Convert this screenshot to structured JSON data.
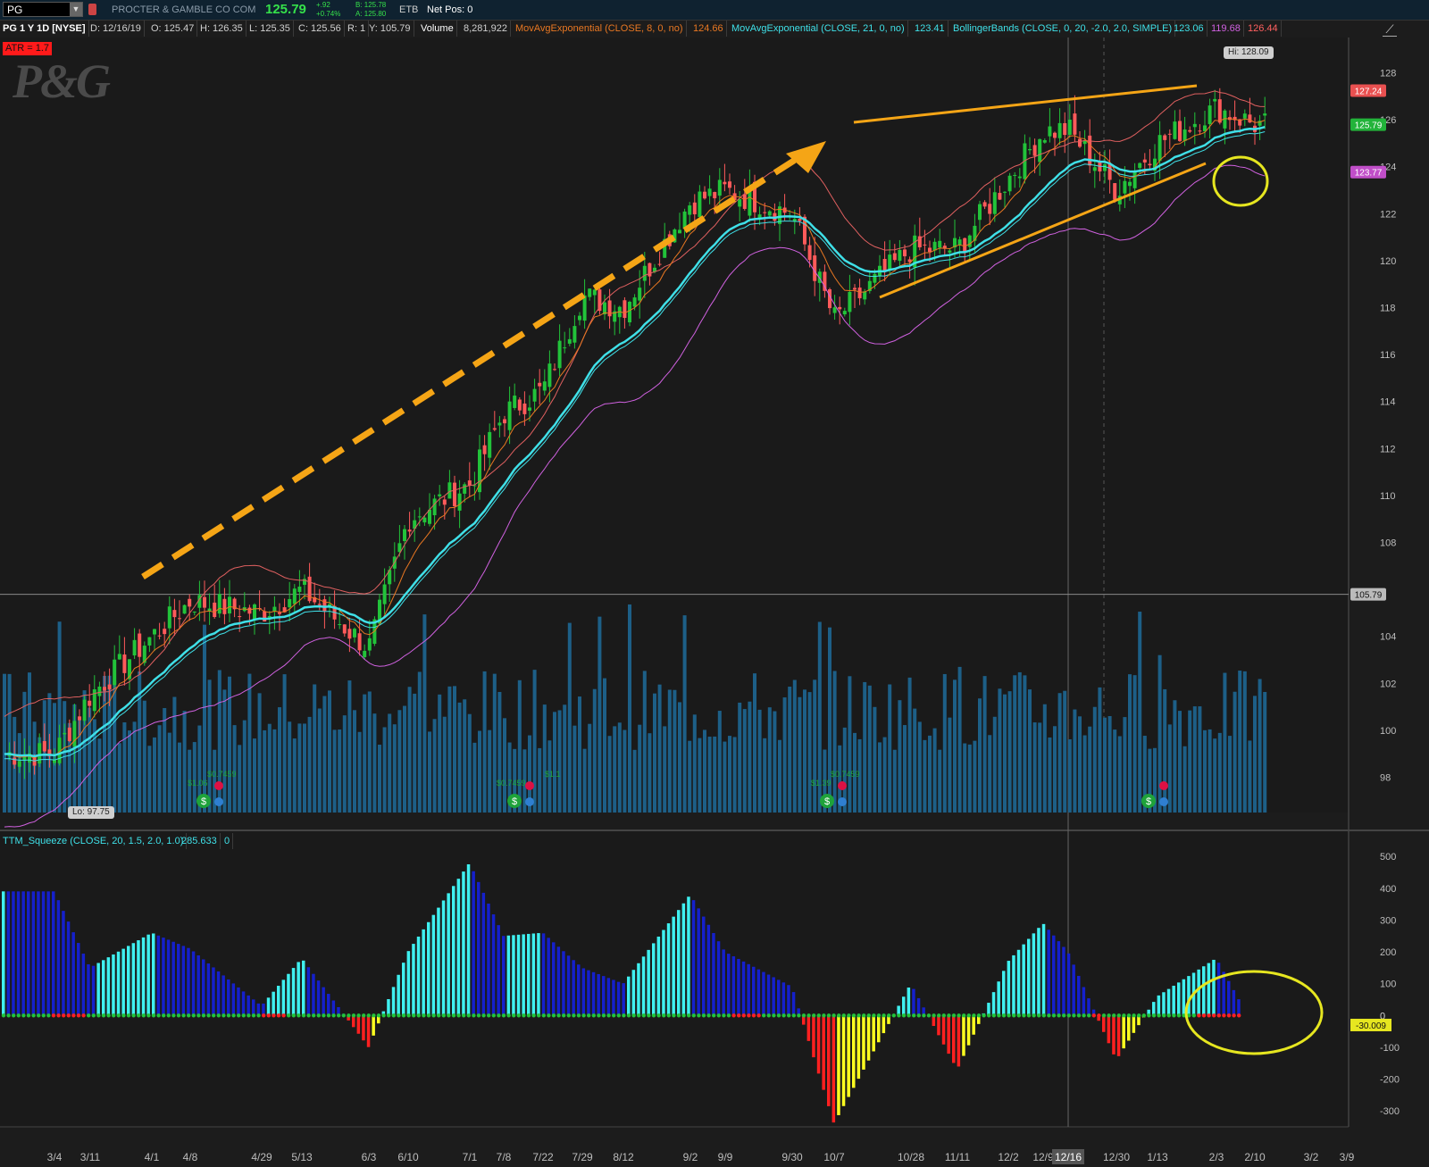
{
  "topbar": {
    "symbol": "PG",
    "company": "PROCTER & GAMBLE CO COM",
    "last": "125.79",
    "change": "+.92",
    "change_pct": "+0.74%",
    "bid": "B: 125.78",
    "ask": "A: 125.80",
    "etb": "ETB",
    "net_pos": "Net Pos: 0"
  },
  "infobar": {
    "title": "PG 1 Y 1D [NYSE]",
    "date": "D: 12/16/19",
    "open": "O: 125.47",
    "high": "H: 126.35",
    "low": "L: 125.35",
    "close": "C: 125.56",
    "r": "R: 1",
    "y": "Y: 105.79",
    "volume_label": "Volume",
    "volume": "8,281,922",
    "ema8_label": "MovAvgExponential (CLOSE, 8, 0, no)",
    "ema8": "124.66",
    "ema21_label": "MovAvgExponential (CLOSE, 21, 0, no)",
    "ema21": "123.41",
    "bb_label": "BollingerBands (CLOSE, 0, 20, -2.0, 2.0, SIMPLE)",
    "bb_mid": "123.06",
    "bb_low": "119.68",
    "bb_up": "126.44"
  },
  "atr": "ATR = 1.7",
  "logo": "P&G",
  "hi_label": "Hi: 128.09",
  "lo_label": "Lo: 97.75",
  "squeeze_header": {
    "label": "TTM_Squeeze (CLOSE, 20, 1.5, 2.0, 1.0)",
    "value": "285.633",
    "zero": "0"
  },
  "dividends": [
    "$1.06",
    "$0.7459",
    "$0.7459",
    "$1.1",
    "$1.39",
    "$0.7459"
  ],
  "colors": {
    "up": "#22c33a",
    "down": "#ff5a5a",
    "ema8": "#e87722",
    "ema21": "#3fe0e8",
    "bb_upper": "#e06060",
    "bb_lower": "#d061e0",
    "volume": "#1d5f87",
    "sq_cyan": "#3ff0f0",
    "sq_blue": "#1520cc",
    "sq_red": "#ff2020",
    "sq_yellow": "#ffff20",
    "trend": "#f5a516",
    "circle": "#e6e620"
  },
  "chart_data": [
    {
      "type": "candlestick",
      "title": "PG 1 Y 1D [NYSE]",
      "x_tick_labels": [
        "3/4",
        "3/11",
        "4/1",
        "4/8",
        "4/29",
        "5/13",
        "6/3",
        "6/10",
        "7/1",
        "7/8",
        "7/22",
        "7/29",
        "8/12",
        "9/2",
        "9/9",
        "9/30",
        "10/7",
        "10/28",
        "11/11",
        "12/2",
        "12/9",
        "12/16",
        "12/30",
        "1/13",
        "2/3",
        "2/10",
        "3/2",
        "3/9"
      ],
      "y_ticks": [
        98,
        100,
        102,
        104,
        106,
        108,
        110,
        112,
        114,
        116,
        118,
        120,
        122,
        124,
        126,
        128
      ],
      "ylim": [
        96.5,
        129.5
      ],
      "price_badges": {
        "bb_upper": "127.24",
        "last": "125.79",
        "bb_lower": "123.77",
        "crosshair": "105.79"
      },
      "crosshair_date": "12/16",
      "approx_close_path": [
        [
          "3/4",
          99.0
        ],
        [
          "3/11",
          101.5
        ],
        [
          "4/1",
          104.0
        ],
        [
          "4/8",
          105.5
        ],
        [
          "4/29",
          105.0
        ],
        [
          "5/13",
          106.0
        ],
        [
          "6/3",
          103.5
        ],
        [
          "6/10",
          109.0
        ],
        [
          "7/1",
          110.5
        ],
        [
          "7/8",
          113.5
        ],
        [
          "7/22",
          114.5
        ],
        [
          "7/29",
          118.5
        ],
        [
          "8/12",
          118.0
        ],
        [
          "9/2",
          122.5
        ],
        [
          "9/9",
          123.0
        ],
        [
          "9/30",
          122.0
        ],
        [
          "10/7",
          117.5
        ],
        [
          "10/28",
          120.5
        ],
        [
          "11/11",
          120.5
        ],
        [
          "12/2",
          123.5
        ],
        [
          "12/9",
          125.5
        ],
        [
          "12/16",
          125.6
        ],
        [
          "12/30",
          123.0
        ],
        [
          "1/13",
          125.0
        ],
        [
          "2/3",
          126.5
        ],
        [
          "2/10",
          125.8
        ]
      ]
    },
    {
      "type": "bar",
      "title": "TTM_Squeeze (CLOSE, 20, 1.5, 2.0, 1.0)",
      "y_ticks": [
        -300,
        -200,
        -100,
        0,
        100,
        200,
        300,
        400,
        500
      ],
      "ylim": [
        -350,
        520
      ],
      "current_value_badge": "-30.009",
      "approx_histogram": [
        [
          "3/4",
          390
        ],
        [
          "3/11",
          150
        ],
        [
          "4/1",
          260
        ],
        [
          "4/8",
          210
        ],
        [
          "4/29",
          30
        ],
        [
          "5/13",
          180
        ],
        [
          "6/3",
          -100
        ],
        [
          "6/10",
          200
        ],
        [
          "7/1",
          480
        ],
        [
          "7/8",
          250
        ],
        [
          "7/22",
          260
        ],
        [
          "7/29",
          150
        ],
        [
          "8/12",
          100
        ],
        [
          "9/2",
          380
        ],
        [
          "9/9",
          200
        ],
        [
          "9/30",
          90
        ],
        [
          "10/7",
          -340
        ],
        [
          "10/28",
          100
        ],
        [
          "11/11",
          -170
        ],
        [
          "12/2",
          170
        ],
        [
          "12/9",
          290
        ],
        [
          "12/16",
          200
        ],
        [
          "12/30",
          -140
        ],
        [
          "1/13",
          60
        ],
        [
          "2/3",
          180
        ],
        [
          "2/10",
          -40
        ]
      ]
    }
  ]
}
